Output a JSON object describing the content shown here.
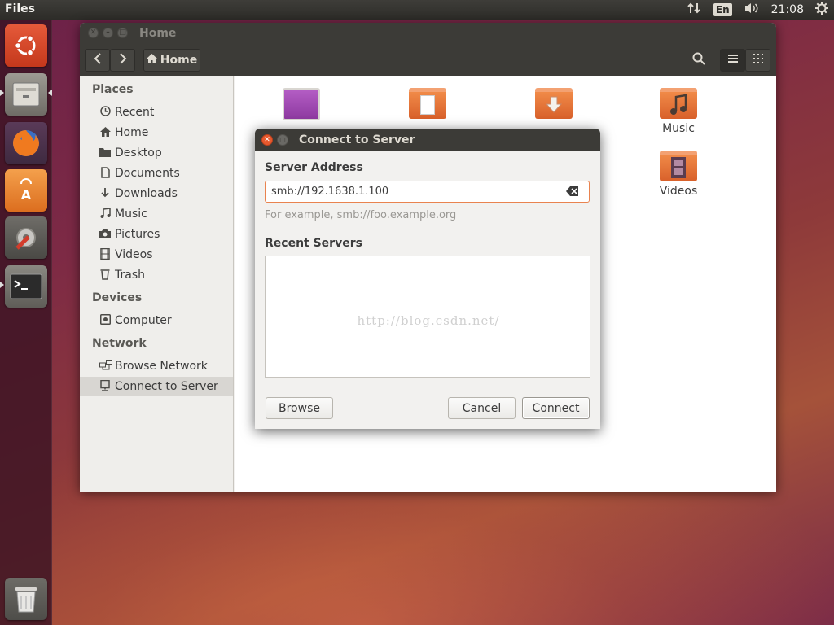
{
  "top_panel": {
    "app_title": "Files",
    "keyboard_layout": "En",
    "clock": "21:08",
    "icons": [
      "network-arrows-icon",
      "volume-icon",
      "settings-gear-icon"
    ]
  },
  "launcher": {
    "items": [
      "ubuntu-logo-icon",
      "files-icon",
      "firefox-icon",
      "software-center-icon",
      "system-settings-icon",
      "terminal-icon",
      "trash-icon"
    ]
  },
  "files_window": {
    "title": "Home",
    "path_button": "Home",
    "sidebar": {
      "places_header": "Places",
      "places": [
        {
          "label": "Recent",
          "icon": "clock-icon"
        },
        {
          "label": "Home",
          "icon": "home-icon"
        },
        {
          "label": "Desktop",
          "icon": "folder-icon"
        },
        {
          "label": "Documents",
          "icon": "document-icon"
        },
        {
          "label": "Downloads",
          "icon": "download-icon"
        },
        {
          "label": "Music",
          "icon": "music-icon"
        },
        {
          "label": "Pictures",
          "icon": "camera-icon"
        },
        {
          "label": "Videos",
          "icon": "film-icon"
        },
        {
          "label": "Trash",
          "icon": "trash-icon"
        }
      ],
      "devices_header": "Devices",
      "devices": [
        {
          "label": "Computer",
          "icon": "computer-icon"
        }
      ],
      "network_header": "Network",
      "network": [
        {
          "label": "Browse Network",
          "icon": "network-icon"
        },
        {
          "label": "Connect to Server",
          "icon": "server-icon",
          "active": true
        }
      ]
    },
    "content_folders": [
      {
        "label": "Music"
      },
      {
        "label": "Videos"
      }
    ]
  },
  "dialog": {
    "title": "Connect to Server",
    "server_address_label": "Server Address",
    "server_address_value": "smb://192.1638.1.100",
    "example_hint": "For example, smb://foo.example.org",
    "recent_servers_label": "Recent Servers",
    "watermark": "http://blog.csdn.net/",
    "buttons": {
      "browse": "Browse",
      "cancel": "Cancel",
      "connect": "Connect"
    }
  },
  "colors": {
    "accent_orange": "#e9834f",
    "titlebar": "#3c3b37",
    "close_button": "#e8592e"
  }
}
